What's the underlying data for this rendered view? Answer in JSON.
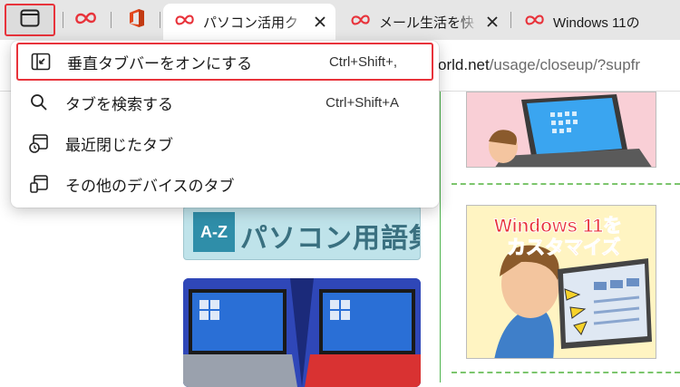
{
  "colors": {
    "highlight_border": "#e8333b",
    "tab_strip_bg": "#e6e6e6",
    "brand_red": "#e8333b",
    "rule_green": "#4fb34f"
  },
  "tabstrip": {
    "tab_actions_icon": "vertical-tabs-icon",
    "tabs": [
      {
        "title": "パソコン活用ク",
        "active": true
      },
      {
        "title": "メール生活を快",
        "active": false
      },
      {
        "title": "Windows 11の",
        "active": false
      }
    ],
    "close_label": "×"
  },
  "address": {
    "host": "orld.net",
    "path": "/usage/closeup/?supfr"
  },
  "menu": {
    "items": [
      {
        "label": "垂直タブバーをオンにする",
        "shortcut": "Ctrl+Shift+,",
        "icon": "vertical-tabs-icon"
      },
      {
        "label": "タブを検索する",
        "shortcut": "Ctrl+Shift+A",
        "icon": "search-icon"
      },
      {
        "label": "最近閉じたタブ",
        "shortcut": "",
        "icon": "recently-closed-icon"
      },
      {
        "label": "その他のデバイスのタブ",
        "shortcut": "",
        "icon": "other-devices-icon"
      }
    ]
  },
  "content": {
    "banner_badge": "A-Z",
    "banner_text": "パソコン用語集",
    "promo_text_1": "Windows 11を",
    "promo_text_2": "カスタマイズ"
  }
}
